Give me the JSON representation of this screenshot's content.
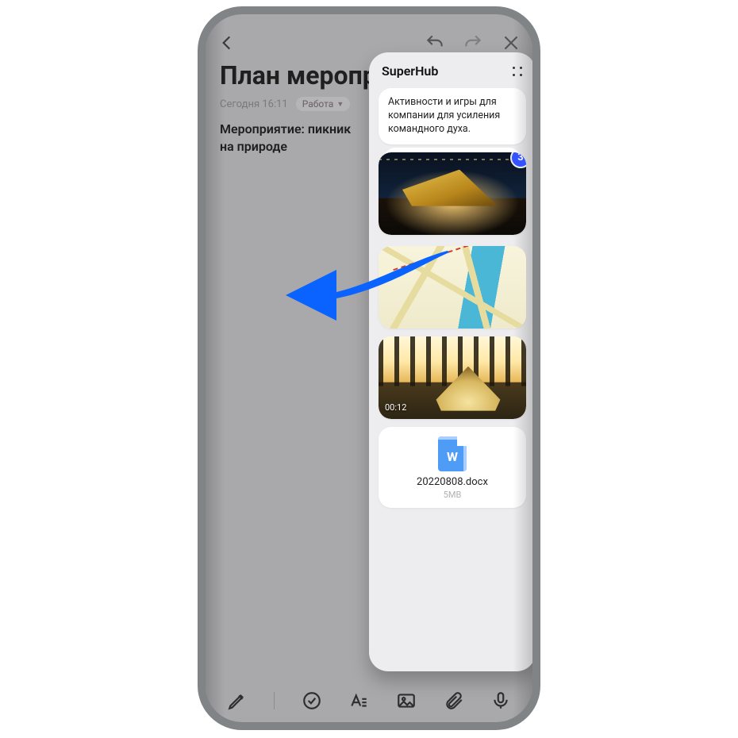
{
  "toolbar": {
    "back": "back",
    "undo": "undo",
    "redo": "redo",
    "close": "close"
  },
  "note": {
    "title": "План меропр",
    "timestamp": "Сегодня 16:11",
    "category": "Работа",
    "body": "Мероприятие: пикник на природе"
  },
  "superhub": {
    "title": "SuperHub",
    "items": [
      {
        "type": "text",
        "content": "Активности и игры для компании для усиления командного духа."
      },
      {
        "type": "image_stack",
        "badge": "3"
      },
      {
        "type": "map"
      },
      {
        "type": "video",
        "duration": "00:12"
      },
      {
        "type": "file",
        "filename": "20220808.docx",
        "filesize": "5MB"
      }
    ]
  },
  "bottombar": {
    "pen": "pen",
    "check": "check-circle",
    "text_style": "text-style",
    "image": "image",
    "attach": "attach",
    "mic": "mic"
  }
}
